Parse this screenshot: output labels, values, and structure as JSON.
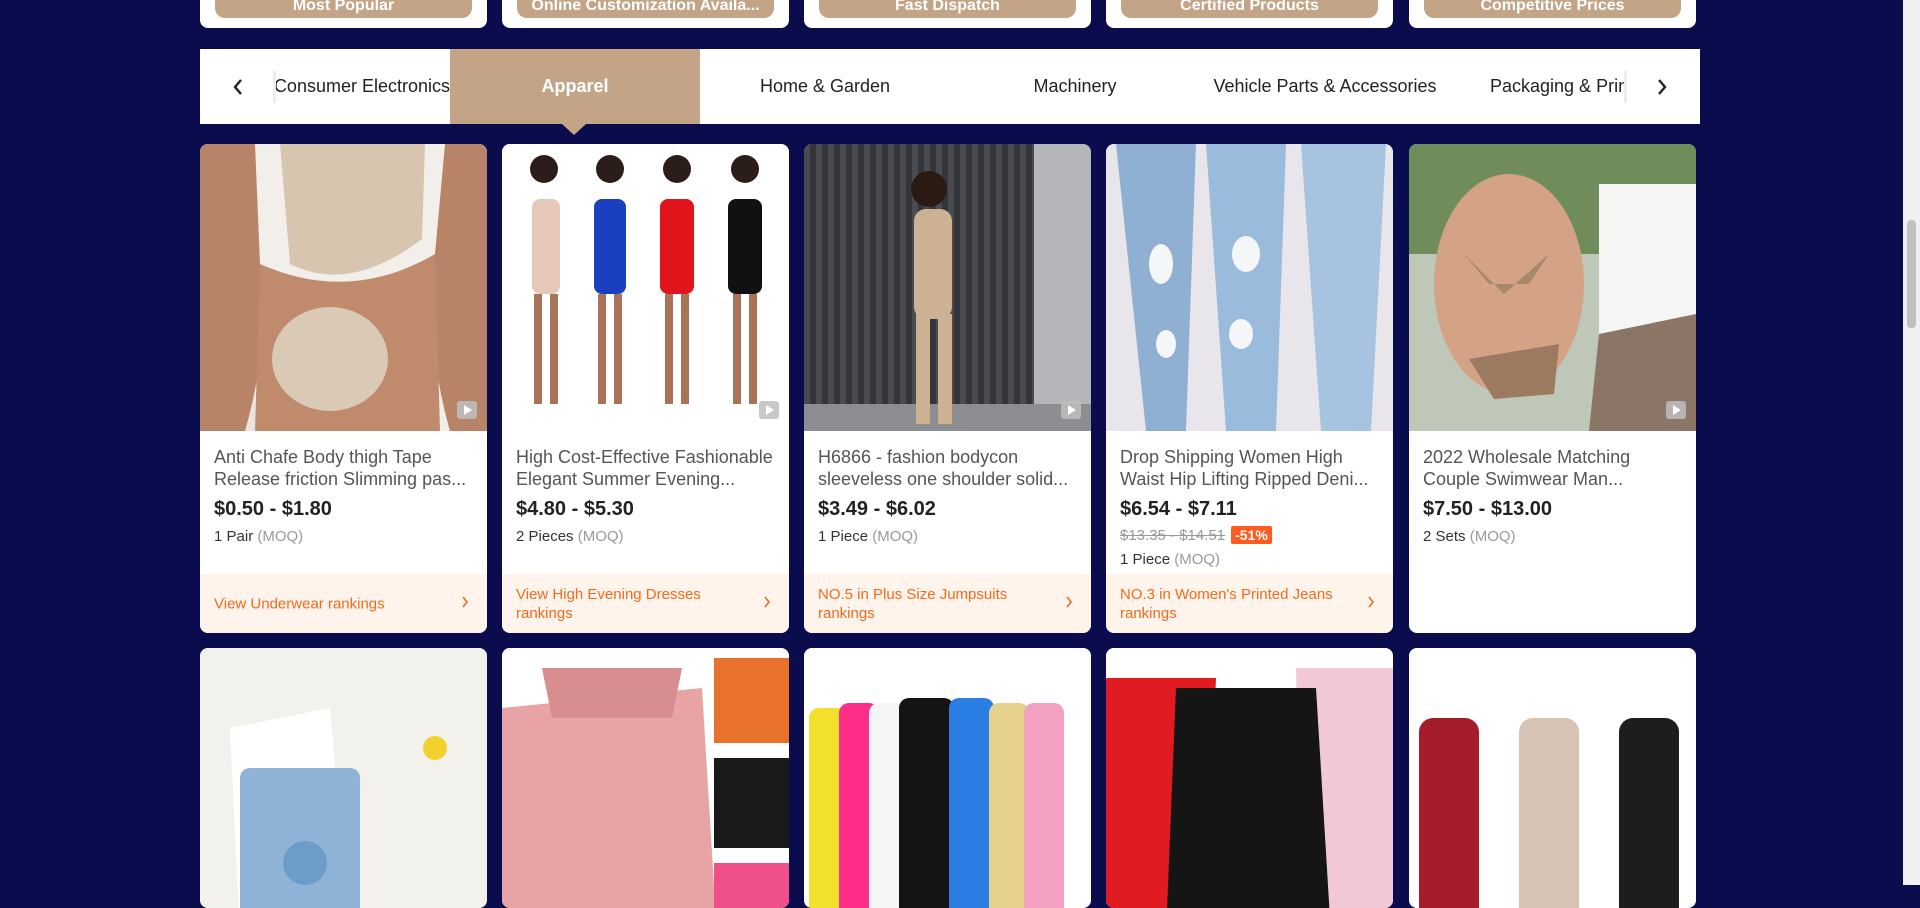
{
  "badges": [
    "Most Popular",
    "Online Customization Availa...",
    "Fast Dispatch",
    "Certified Products",
    "Competitive Prices"
  ],
  "categories": {
    "tabs": [
      "Consumer Electronics",
      "Apparel",
      "Home & Garden",
      "Machinery",
      "Vehicle Parts & Accessories",
      "Packaging & Printing"
    ],
    "active": "Apparel"
  },
  "products": [
    {
      "title": "Anti Chafe Body thigh Tape Release friction Slimming pas...",
      "price": "$0.50 - $1.80",
      "moq_qty": "1 Pair",
      "moq_unit": "(MOQ)",
      "rank": "View Underwear rankings",
      "has_video": true
    },
    {
      "title": "High Cost-Effective Fashionable Elegant Summer Evening...",
      "price": "$4.80 - $5.30",
      "moq_qty": "2 Pieces",
      "moq_unit": "(MOQ)",
      "rank": "View High Evening Dresses rankings",
      "has_video": true
    },
    {
      "title": "H6866 - fashion bodycon sleeveless one shoulder solid...",
      "price": "$3.49 - $6.02",
      "moq_qty": "1 Piece",
      "moq_unit": "(MOQ)",
      "rank": "NO.5 in Plus Size Jumpsuits rankings",
      "has_video": true
    },
    {
      "title": "Drop Shipping Women High Waist Hip Lifting Ripped Deni...",
      "price": "$6.54 - $7.11",
      "orig_price": "$13.35 - $14.51",
      "discount": "-51%",
      "moq_qty": "1 Piece",
      "moq_unit": "(MOQ)",
      "rank": "NO.3 in Women's Printed Jeans rankings",
      "has_video": false
    },
    {
      "title": "2022 Wholesale Matching Couple Swimwear Man...",
      "price": "$7.50 - $13.00",
      "moq_qty": "2 Sets",
      "moq_unit": "(MOQ)",
      "has_video": true
    }
  ],
  "colors": {
    "background": "#0b0c4e",
    "accent": "#c4a487",
    "rank_text": "#f26a1b",
    "rank_bg": "#fff4ec",
    "discount": "#ff5a1f"
  }
}
